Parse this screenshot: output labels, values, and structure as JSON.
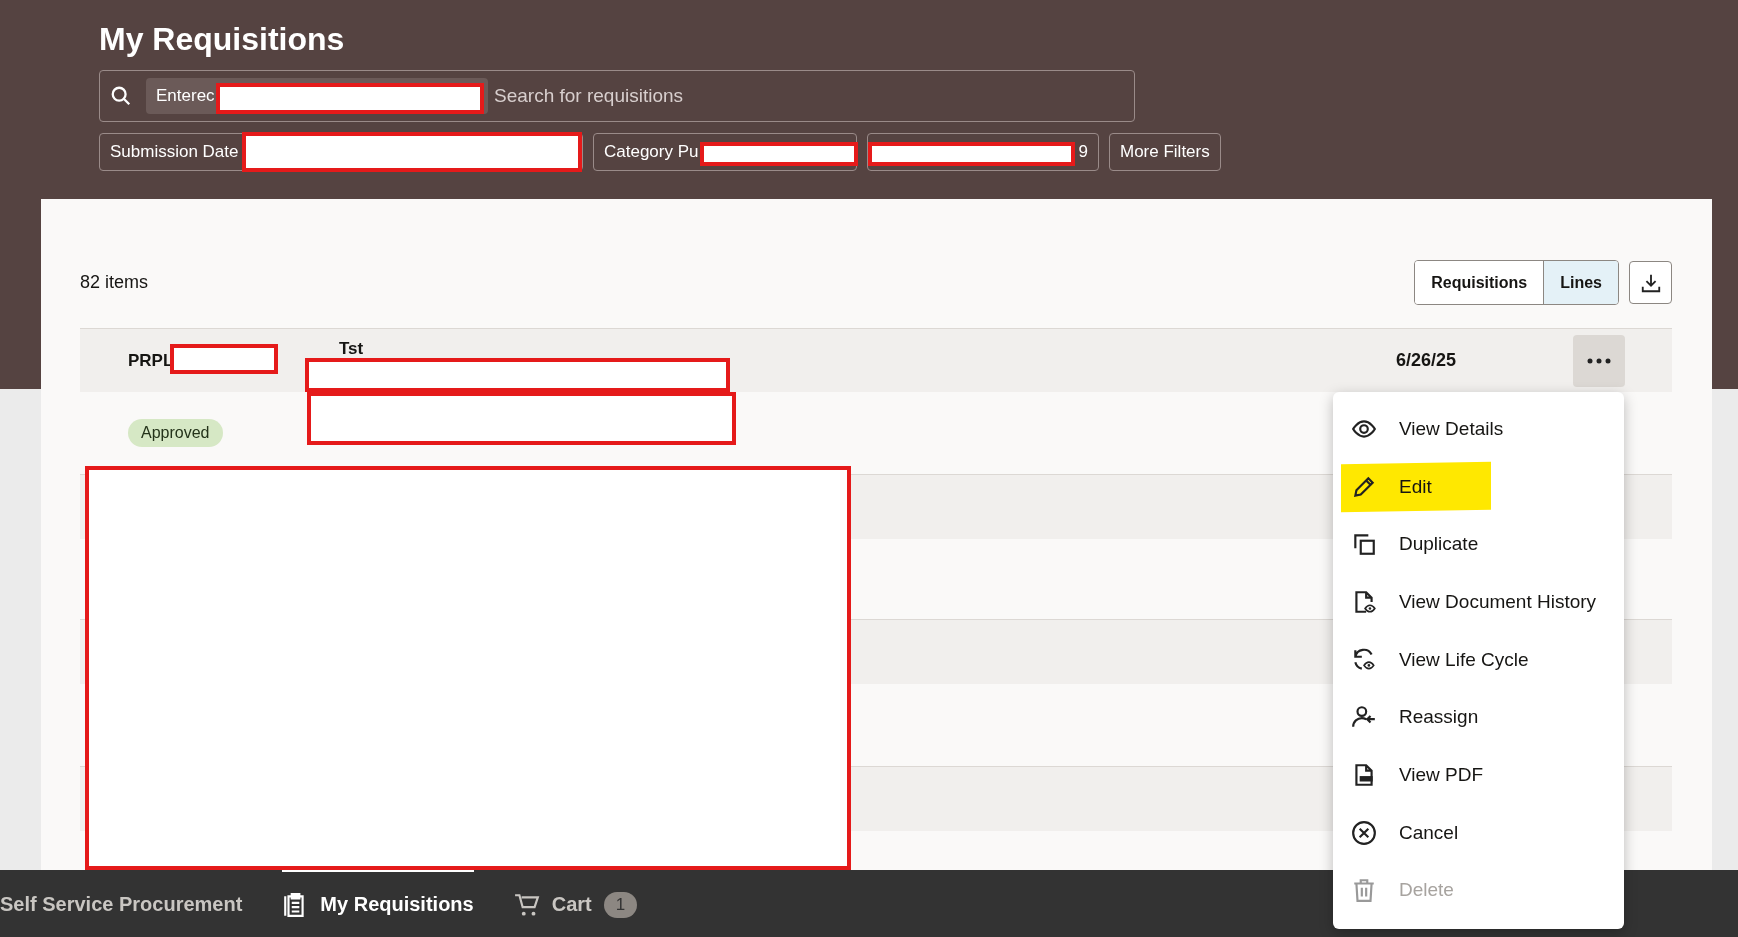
{
  "header": {
    "title": "My Requisitions",
    "search": {
      "chip": "Enterec",
      "placeholder": "Search for requisitions"
    },
    "filters": [
      {
        "label": "Submission Date"
      },
      {
        "label": "Category Pu"
      },
      {
        "label": "9"
      },
      {
        "label": "More Filters"
      }
    ]
  },
  "list": {
    "count": "82 items",
    "views": [
      {
        "label": "Requisitions",
        "selected": false
      },
      {
        "label": "Lines",
        "selected": true
      }
    ],
    "rows": [
      {
        "number": "PRPL",
        "description": "Tst",
        "date": "6/26/25",
        "status": "Approved"
      }
    ]
  },
  "menu": {
    "items": [
      {
        "label": "View Details",
        "kind": "eye",
        "disabled": false,
        "highlighted": false
      },
      {
        "label": "Edit",
        "kind": "pencil",
        "disabled": false,
        "highlighted": true
      },
      {
        "label": "Duplicate",
        "kind": "copy",
        "disabled": false,
        "highlighted": false
      },
      {
        "label": "View Document History",
        "kind": "history",
        "disabled": false,
        "highlighted": false
      },
      {
        "label": "View Life Cycle",
        "kind": "cycle",
        "disabled": false,
        "highlighted": false
      },
      {
        "label": "Reassign",
        "kind": "person",
        "disabled": false,
        "highlighted": false
      },
      {
        "label": "View PDF",
        "kind": "pdf",
        "disabled": false,
        "highlighted": false
      },
      {
        "label": "Cancel",
        "kind": "cancel",
        "disabled": false,
        "highlighted": false
      },
      {
        "label": "Delete",
        "kind": "trash",
        "disabled": true,
        "highlighted": false
      }
    ]
  },
  "nav": {
    "items": [
      {
        "label": "Self Service Procurement",
        "kind": "text",
        "selected": false
      },
      {
        "label": "My Requisitions",
        "kind": "requisitions",
        "selected": true
      },
      {
        "label": "Cart",
        "kind": "cart",
        "selected": false,
        "badge": "1"
      }
    ]
  }
}
